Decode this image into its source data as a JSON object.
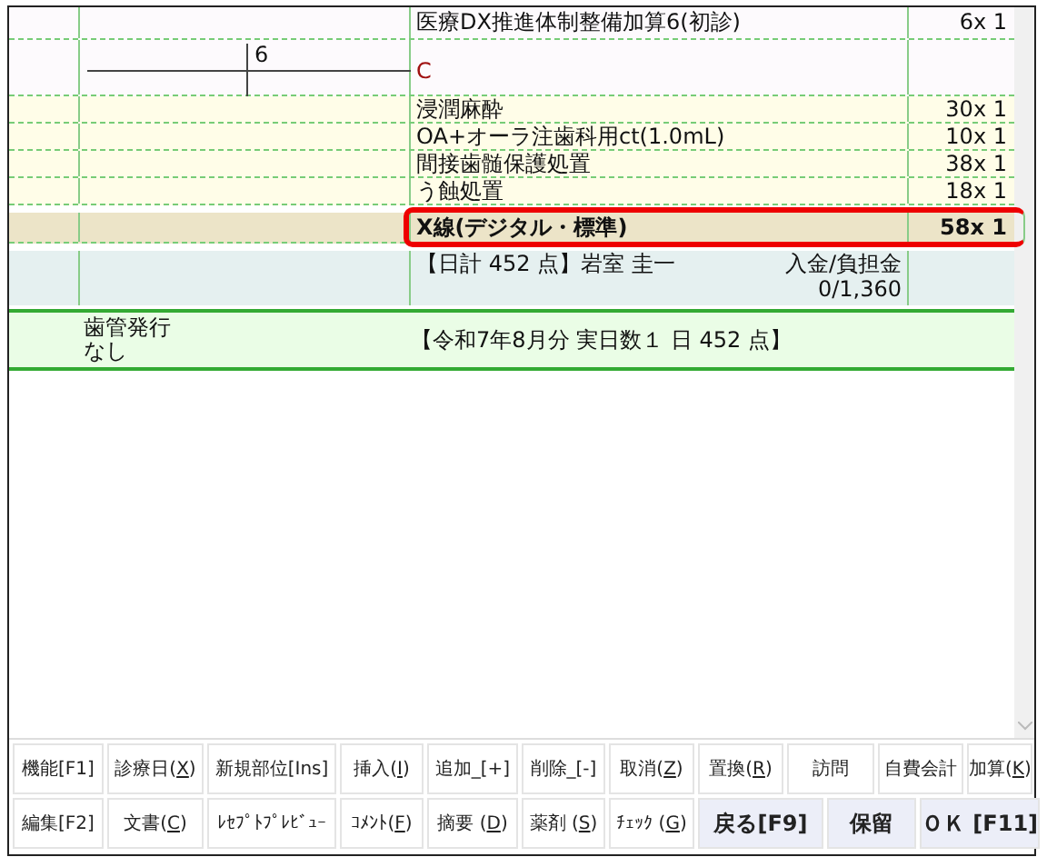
{
  "header_row": {
    "name": "医療DX推進体制整備加算6(初診)",
    "points": "6x 1"
  },
  "tooth_row": {
    "tooth": "6",
    "diagnosis": "C"
  },
  "procedures": [
    {
      "name": "浸潤麻酔",
      "points": "30x 1",
      "selected": false,
      "annotated": false
    },
    {
      "name": "OA+オーラ注歯科用ct(1.0mL)",
      "points": "10x 1",
      "selected": false,
      "annotated": false
    },
    {
      "name": "間接歯髄保護処置",
      "points": "38x 1",
      "selected": false,
      "annotated": false
    },
    {
      "name": "う蝕処置",
      "points": "18x 1",
      "selected": false,
      "annotated": false
    },
    {
      "name": "X線(デジタル・標準)",
      "points": "58x 1",
      "selected": true,
      "annotated": true
    }
  ],
  "daily_total": {
    "summary": "【日計 452 点】岩室 圭一",
    "payment_label": "入金/負担金",
    "payment": "0/1,360"
  },
  "monthly": {
    "status_label": "歯管発行",
    "status_value": "なし",
    "summary": "【令和7年8月分 実日数１ 日  452 点】"
  },
  "buttons": [
    [
      {
        "pre": "機能[F1]",
        "kind": "normal"
      },
      {
        "pre": "診療日(",
        "key": "X",
        "post": ")",
        "kind": "normal"
      },
      {
        "pre": "新規部位[Ins]",
        "kind": "normal"
      },
      {
        "pre": "挿入(",
        "key": "I",
        "post": ")",
        "kind": "normal"
      },
      {
        "pre": "追加_[+]",
        "kind": "normal"
      },
      {
        "pre": "削除_[-]",
        "kind": "normal"
      },
      {
        "pre": "取消(",
        "key": "Z",
        "post": ")",
        "kind": "normal"
      },
      {
        "pre": "置換(",
        "key": "R",
        "post": ")",
        "kind": "normal"
      },
      {
        "pre": "訪問",
        "kind": "normal"
      },
      {
        "pre": "自費会計",
        "kind": "normal"
      },
      {
        "pre": "加算(",
        "key": "K",
        "post": ")",
        "kind": "normal"
      }
    ],
    [
      {
        "pre": "編集[F2]",
        "kind": "normal"
      },
      {
        "pre": "文書(",
        "key": "C",
        "post": ")",
        "kind": "normal"
      },
      {
        "pre": "ﾚｾﾌﾟﾄﾌﾟﾚﾋﾞｭｰ",
        "kind": "normal"
      },
      {
        "pre": "ｺﾒﾝﾄ(",
        "key": "F",
        "post": ")",
        "kind": "normal"
      },
      {
        "pre": "摘要 (",
        "key": "D",
        "post": ")",
        "kind": "normal"
      },
      {
        "pre": "薬剤 (",
        "key": "S",
        "post": ")",
        "kind": "normal"
      },
      {
        "pre": "ﾁｪｯｸ (",
        "key": "G",
        "post": ")",
        "kind": "normal"
      },
      {
        "pre": "戻る[F9]",
        "kind": "primary"
      },
      {
        "pre": "保留",
        "kind": "primary"
      },
      {
        "pre": "ＯＫ [F11]",
        "kind": "primary"
      }
    ]
  ]
}
